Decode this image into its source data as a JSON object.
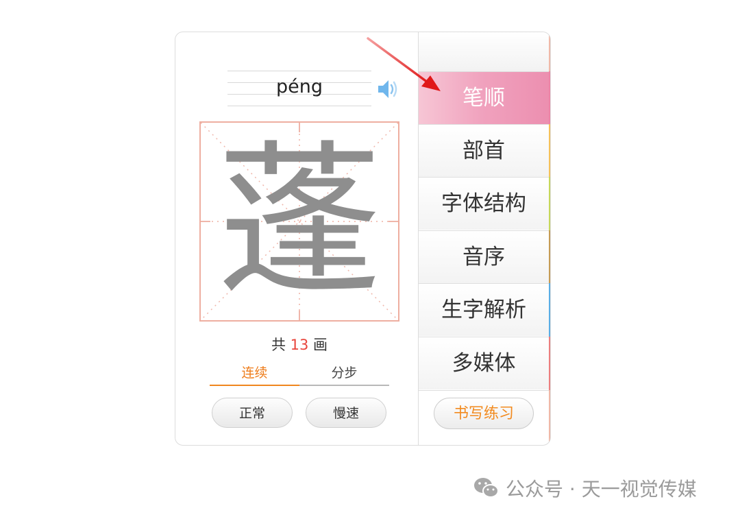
{
  "pinyin": "péng",
  "character": "蓬",
  "stroke_count": {
    "prefix": "共",
    "number": "13",
    "suffix": "画"
  },
  "mode_tabs": [
    {
      "label": "连续",
      "active": true
    },
    {
      "label": "分步",
      "active": false
    }
  ],
  "speed_buttons": [
    "正常",
    "慢速"
  ],
  "menu": {
    "items": [
      {
        "label": "笔顺",
        "active": true,
        "strip_color": "#ee83a6"
      },
      {
        "label": "部首",
        "active": false,
        "strip_color": "#f6c25a"
      },
      {
        "label": "字体结构",
        "active": false,
        "strip_color": "#c7d85a"
      },
      {
        "label": "音序",
        "active": false,
        "strip_color": "#c69c55"
      },
      {
        "label": "生字解析",
        "active": false,
        "strip_color": "#5aaee6"
      },
      {
        "label": "多媒体",
        "active": false,
        "strip_color": "#ec7f7f"
      }
    ],
    "practice_label": "书写练习"
  },
  "watermark": "公众号 · 天一视觉传媒",
  "colors": {
    "accent_orange": "#f0861e",
    "active_pink": "#ec8fb0",
    "stroke_number_red": "#e8453c",
    "grid_border": "#eeaea0",
    "annotation_arrow": "#e02020"
  },
  "icons": {
    "speaker": "speaker-icon",
    "arrow": "red-arrow-annotation",
    "wechat": "wechat-icon"
  }
}
